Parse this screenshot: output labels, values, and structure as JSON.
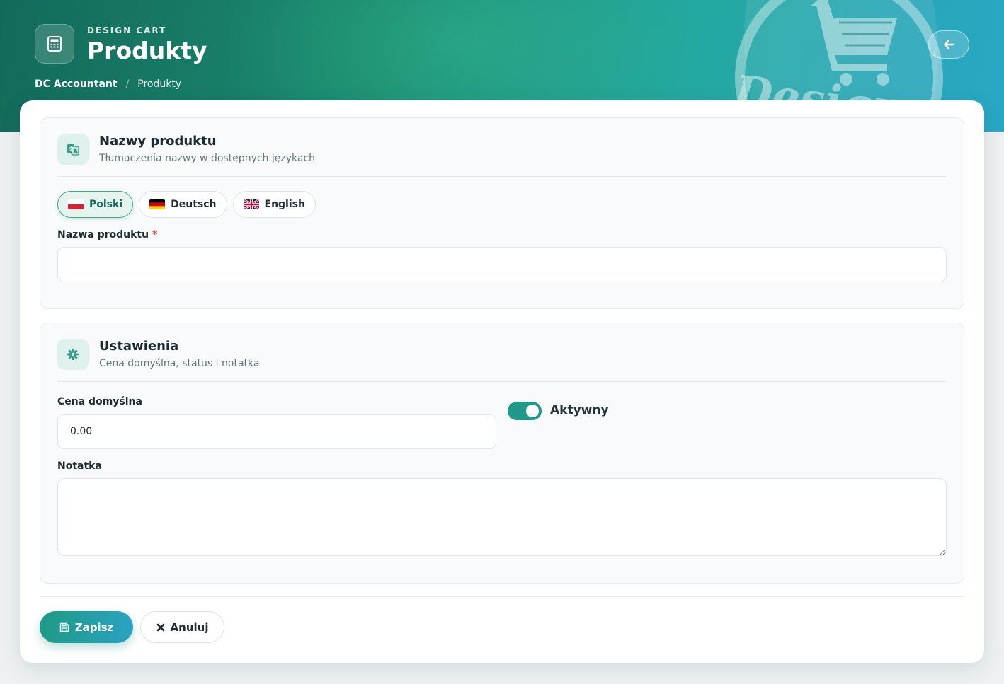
{
  "header": {
    "kicker": "DESIGN CART",
    "title": "Produkty",
    "breadcrumb": {
      "home": "DC Accountant",
      "separator": "/",
      "current": "Produkty"
    },
    "icons": {
      "page": "calculator-icon",
      "back": "arrow-left-icon",
      "watermark": "shopping-cart-logo"
    }
  },
  "names_section": {
    "title": "Nazwy produktu",
    "subtitle": "Tłumaczenia nazwy w dostępnych językach",
    "icon": "translate-icon",
    "languages": [
      {
        "label": "Polski",
        "flag": "pl-flag-icon",
        "active": true
      },
      {
        "label": "Deutsch",
        "flag": "de-flag-icon",
        "active": false
      },
      {
        "label": "English",
        "flag": "gb-flag-icon",
        "active": false
      }
    ],
    "name_label": "Nazwa produktu",
    "required_mark": "*",
    "name_value": ""
  },
  "settings_section": {
    "title": "Ustawienia",
    "subtitle": "Cena domyślna, status i notatka",
    "icon": "gear-icon",
    "price_label": "Cena domyślna",
    "price_value": "0.00",
    "active_label": "Aktywny",
    "active": true,
    "note_label": "Notatka",
    "note_value": ""
  },
  "actions": {
    "save_label": "Zapisz",
    "save_icon": "floppy-disk-icon",
    "cancel_label": "Anuluj",
    "cancel_icon": "close-icon"
  },
  "colors": {
    "accent": "#1f9a8a",
    "active_tab_bg": "#e6f4ef",
    "required": "#d9534f"
  }
}
